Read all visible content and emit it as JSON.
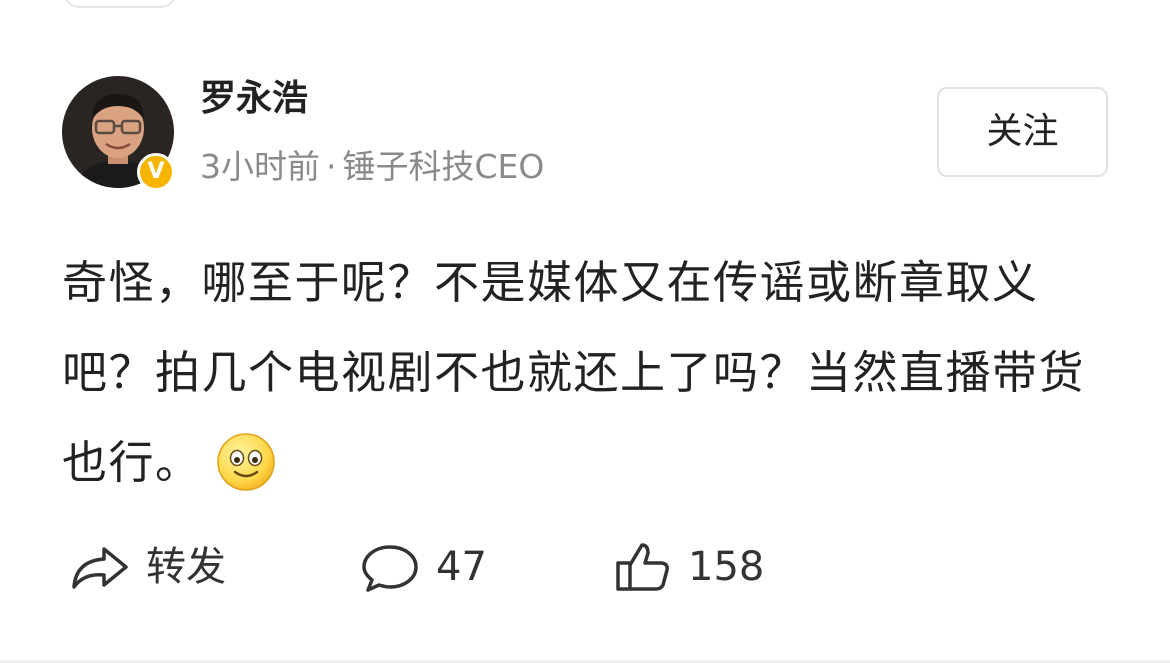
{
  "post": {
    "author": {
      "name": "罗永浩",
      "verified_badge": "V",
      "time": "3小时前",
      "separator": "·",
      "title": "锤子科技CEO"
    },
    "follow_label": "关注",
    "content": "奇怪，哪至于呢？不是媒体又在传谣或断章取义吧？拍几个电视剧不也就还上了吗？当然直播带货也行。",
    "emoji": "smile-emoji"
  },
  "actions": {
    "repost": {
      "label": "转发",
      "icon": "share-arrow-icon"
    },
    "comment": {
      "count": "47",
      "icon": "comment-bubble-icon"
    },
    "like": {
      "count": "158",
      "icon": "thumbs-up-icon"
    }
  },
  "colors": {
    "badge": "#f7b500",
    "meta_text": "#8a8a8a",
    "primary_text": "#222222",
    "emoji_fill": "#ffd84a"
  }
}
